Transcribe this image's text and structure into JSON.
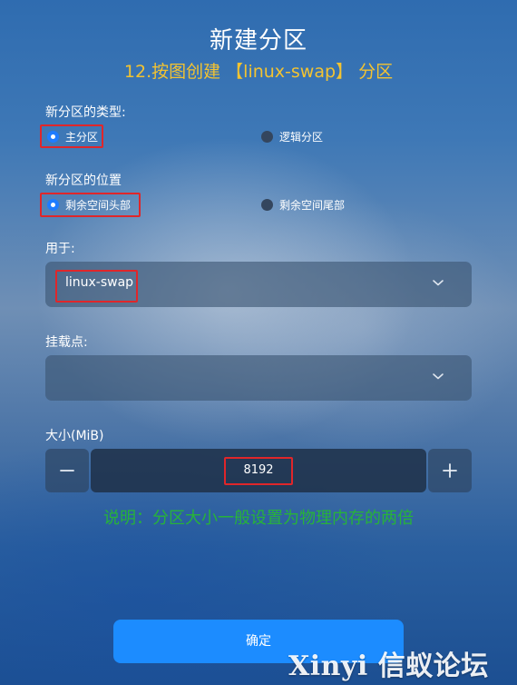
{
  "dialog": {
    "title": "新建分区",
    "annotation": "12.按图创建 【linux-swap】 分区"
  },
  "partition_type": {
    "label": "新分区的类型:",
    "options": [
      {
        "label": "主分区",
        "selected": true
      },
      {
        "label": "逻辑分区",
        "selected": false
      }
    ]
  },
  "partition_location": {
    "label": "新分区的位置",
    "options": [
      {
        "label": "剩余空间头部",
        "selected": true
      },
      {
        "label": "剩余空间尾部",
        "selected": false
      }
    ]
  },
  "filesystem": {
    "label": "用于:",
    "value": "linux-swap",
    "icon": "chevron-down-icon"
  },
  "mount_point": {
    "label": "挂载点:",
    "value": "",
    "icon": "chevron-down-icon"
  },
  "size": {
    "label": "大小(MiB)",
    "value": "8192",
    "decrement_icon": "minus-icon",
    "increment_icon": "plus-icon"
  },
  "note": "说明：分区大小一般设置为物理内存的两倍",
  "confirm_button": "确定",
  "watermark": "Xinyi 信蚁论坛",
  "colors": {
    "accent": "#1c8cff",
    "annotation_yellow": "#f3c331",
    "annotation_red": "#e0262a",
    "note_green": "#27b33a"
  }
}
